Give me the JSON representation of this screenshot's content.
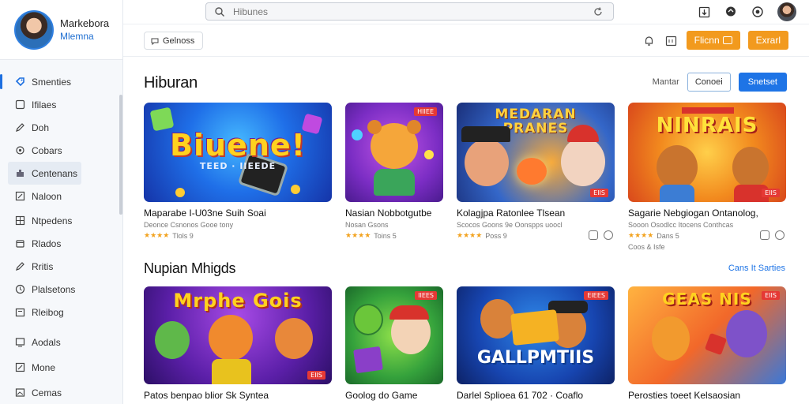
{
  "profile": {
    "name": "Markebora",
    "subtitle": "Mlemna"
  },
  "sidebar": {
    "items": [
      {
        "label": "Smenties",
        "icon": "tag-icon"
      },
      {
        "label": "Ifilaes",
        "icon": "square-icon"
      },
      {
        "label": "Doh",
        "icon": "pencil-icon"
      },
      {
        "label": "Cobars",
        "icon": "gear-icon"
      },
      {
        "label": "Centenans",
        "icon": "puzzle-icon"
      },
      {
        "label": "Naloon",
        "icon": "edit-icon"
      },
      {
        "label": "Ntpedens",
        "icon": "grid-icon"
      },
      {
        "label": "Rlados",
        "icon": "box-icon"
      },
      {
        "label": "Rritis",
        "icon": "pencil-icon"
      },
      {
        "label": "Plalsetons",
        "icon": "clock-icon"
      },
      {
        "label": "Rleibog",
        "icon": "folder-icon"
      },
      {
        "label": "Aodals",
        "icon": "device-icon"
      },
      {
        "label": "Mone",
        "icon": "edit-icon"
      },
      {
        "label": "Cemas",
        "icon": "image-icon"
      }
    ]
  },
  "topbar": {
    "search_placeholder": "Hibunes"
  },
  "subbar": {
    "chip": "Gelnoss",
    "btn1": "Flicnn",
    "btn2": "Exrarl"
  },
  "section1": {
    "title": "Hiburan",
    "controls": {
      "label": "Mantar",
      "outline": "Conoei",
      "primary": "Snetset"
    },
    "cards": [
      {
        "art_title": "Biuene!",
        "art_sub": "TEED · IIEEDE",
        "badge": "",
        "title": "Maparabe I-U03ne Suih Soai",
        "subtitle": "Deonce Csnonos Gooe tony",
        "meta": "Tlols 9"
      },
      {
        "art_title": "",
        "art_sub": "",
        "badge": "HIIEE",
        "title": "Nasian Nobbotgutbe",
        "subtitle": "Nosan Gsons",
        "meta": "Toins 5"
      },
      {
        "art_title": "MEDARAN PRANES",
        "art_sub": "",
        "badge": "EIIS",
        "title": "Kolagjpa Ratonlee Tlsean",
        "subtitle": "Scocos Goons 9e Oonspps uoocl",
        "meta": "Poss 9"
      },
      {
        "art_title": "NINRAIS",
        "art_sub": "",
        "badge": "EIIS",
        "title": "Sagarie Nebgiogan Ontanolog,",
        "subtitle": "Sooon Osodlcc Itocens Conthcas",
        "meta": "Dans 5"
      }
    ],
    "extra_meta": "Coos & Isfe"
  },
  "section2": {
    "title": "Nupian Mhigds",
    "link": "Cans It Sarties",
    "cards": [
      {
        "art_title": "Mrphe Gois",
        "badge": "EIIS",
        "title": "Patos benpao blior Sk Syntea"
      },
      {
        "art_title": "",
        "badge": "IIEES",
        "title": "Goolog do Game"
      },
      {
        "art_title": "GALLPMTIIS",
        "badge": "EIEES",
        "title": "Darlel Splioea 61 702 · Coaflo"
      },
      {
        "art_title": "GEAS NIS",
        "badge": "EIIS",
        "title": "Perosties toeet Kelsaosian"
      }
    ]
  }
}
